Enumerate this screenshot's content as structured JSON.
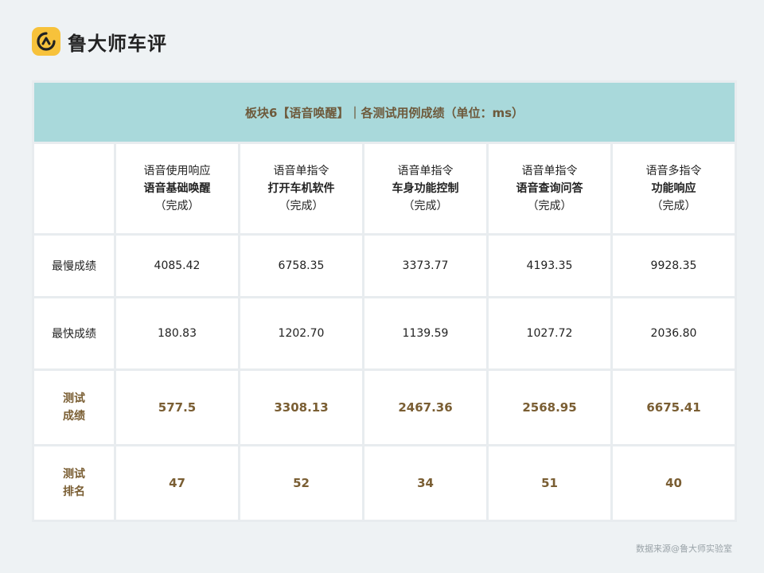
{
  "brand": {
    "name": "鲁大师车评"
  },
  "table": {
    "title": "板块6【语音唤醒】｜各测试用例成绩（单位：ms）",
    "columns": [
      {
        "line1": "语音使用响应",
        "line2": "语音基础唤醒",
        "line3": "（完成）"
      },
      {
        "line1": "语音单指令",
        "line2": "打开车机软件",
        "line3": "（完成）"
      },
      {
        "line1": "语音单指令",
        "line2": "车身功能控制",
        "line3": "（完成）"
      },
      {
        "line1": "语音单指令",
        "line2": "语音查询问答",
        "line3": "（完成）"
      },
      {
        "line1": "语音多指令",
        "line2": "功能响应",
        "line3": "（完成）"
      }
    ],
    "rows": {
      "slowest": {
        "label": "最慢成绩",
        "values": [
          "4085.42",
          "6758.35",
          "3373.77",
          "4193.35",
          "9928.35"
        ]
      },
      "fastest": {
        "label": "最快成绩",
        "values": [
          "180.83",
          "1202.70",
          "1139.59",
          "1027.72",
          "2036.80"
        ]
      },
      "score": {
        "label_line1": "测试",
        "label_line2": "成绩",
        "values": [
          "577.5",
          "3308.13",
          "2467.36",
          "2568.95",
          "6675.41"
        ]
      },
      "rank": {
        "label_line1": "测试",
        "label_line2": "排名",
        "values": [
          "47",
          "52",
          "34",
          "51",
          "40"
        ]
      }
    }
  },
  "source": "数据来源@鲁大师实验室",
  "colors": {
    "accent": "#a9d9db",
    "highlight_text": "#7a5e33",
    "logo": "#f7c23b"
  }
}
